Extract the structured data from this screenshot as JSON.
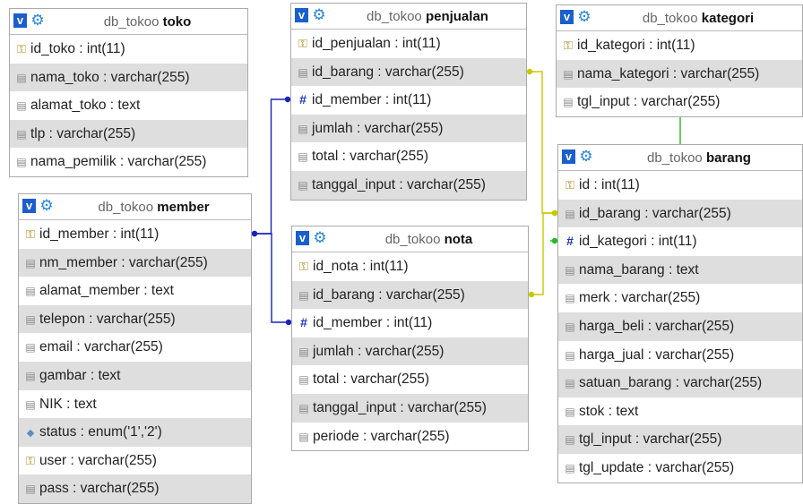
{
  "db_prefix": "db_tokoo",
  "tables": [
    {
      "id": "toko",
      "name": "toko",
      "columns": [
        {
          "text": "id_toko : int(11)",
          "icon": "key-icon"
        },
        {
          "text": "nama_toko : varchar(255)",
          "icon": "column-icon"
        },
        {
          "text": "alamat_toko : text",
          "icon": "column-icon"
        },
        {
          "text": "tlp : varchar(255)",
          "icon": "column-icon"
        },
        {
          "text": "nama_pemilik : varchar(255)",
          "icon": "column-icon"
        }
      ]
    },
    {
      "id": "member",
      "name": "member",
      "columns": [
        {
          "text": "id_member : int(11)",
          "icon": "key-icon"
        },
        {
          "text": "nm_member : varchar(255)",
          "icon": "column-icon"
        },
        {
          "text": "alamat_member : text",
          "icon": "column-icon"
        },
        {
          "text": "telepon : varchar(255)",
          "icon": "column-icon"
        },
        {
          "text": "email : varchar(255)",
          "icon": "column-icon"
        },
        {
          "text": "gambar : text",
          "icon": "column-icon"
        },
        {
          "text": "NIK : text",
          "icon": "column-icon"
        },
        {
          "text": "status : enum('1','2')",
          "icon": "enum-icon"
        },
        {
          "text": "user : varchar(255)",
          "icon": "key-icon"
        },
        {
          "text": "pass : varchar(255)",
          "icon": "column-icon"
        }
      ]
    },
    {
      "id": "penjualan",
      "name": "penjualan",
      "columns": [
        {
          "text": "id_penjualan : int(11)",
          "icon": "key-icon"
        },
        {
          "text": "id_barang : varchar(255)",
          "icon": "column-icon"
        },
        {
          "text": "id_member : int(11)",
          "icon": "foreign-key-icon"
        },
        {
          "text": "jumlah : varchar(255)",
          "icon": "column-icon"
        },
        {
          "text": "total : varchar(255)",
          "icon": "column-icon"
        },
        {
          "text": "tanggal_input : varchar(255)",
          "icon": "column-icon"
        }
      ]
    },
    {
      "id": "nota",
      "name": "nota",
      "columns": [
        {
          "text": "id_nota : int(11)",
          "icon": "key-icon"
        },
        {
          "text": "id_barang : varchar(255)",
          "icon": "column-icon"
        },
        {
          "text": "id_member : int(11)",
          "icon": "foreign-key-icon"
        },
        {
          "text": "jumlah : varchar(255)",
          "icon": "column-icon"
        },
        {
          "text": "total : varchar(255)",
          "icon": "column-icon"
        },
        {
          "text": "tanggal_input : varchar(255)",
          "icon": "column-icon"
        },
        {
          "text": "periode : varchar(255)",
          "icon": "column-icon"
        }
      ]
    },
    {
      "id": "kategori",
      "name": "kategori",
      "columns": [
        {
          "text": "id_kategori : int(11)",
          "icon": "key-icon"
        },
        {
          "text": "nama_kategori : varchar(255)",
          "icon": "column-icon"
        },
        {
          "text": "tgl_input : varchar(255)",
          "icon": "column-icon"
        }
      ]
    },
    {
      "id": "barang",
      "name": "barang",
      "columns": [
        {
          "text": "id : int(11)",
          "icon": "key-icon"
        },
        {
          "text": "id_barang : varchar(255)",
          "icon": "column-icon"
        },
        {
          "text": "id_kategori : int(11)",
          "icon": "foreign-key-icon"
        },
        {
          "text": "nama_barang : text",
          "icon": "column-icon"
        },
        {
          "text": "merk : varchar(255)",
          "icon": "column-icon"
        },
        {
          "text": "harga_beli : varchar(255)",
          "icon": "column-icon"
        },
        {
          "text": "harga_jual : varchar(255)",
          "icon": "column-icon"
        },
        {
          "text": "satuan_barang : varchar(255)",
          "icon": "column-icon"
        },
        {
          "text": "stok : text",
          "icon": "column-icon"
        },
        {
          "text": "tgl_input : varchar(255)",
          "icon": "column-icon"
        },
        {
          "text": "tgl_update : varchar(255)",
          "icon": "column-icon"
        }
      ]
    }
  ],
  "relations": [
    {
      "from": "member.id_member",
      "to": "penjualan.id_member",
      "color": "#1a22b8"
    },
    {
      "from": "member.id_member",
      "to": "nota.id_member",
      "color": "#1a22b8"
    },
    {
      "from": "penjualan.id_barang",
      "to": "barang.id_barang",
      "color": "#c8c800"
    },
    {
      "from": "nota.id_barang",
      "to": "barang.id_barang",
      "color": "#c8c800"
    },
    {
      "from": "kategori.id_kategori",
      "to": "barang.id_kategori",
      "color": "#22bb22"
    }
  ]
}
